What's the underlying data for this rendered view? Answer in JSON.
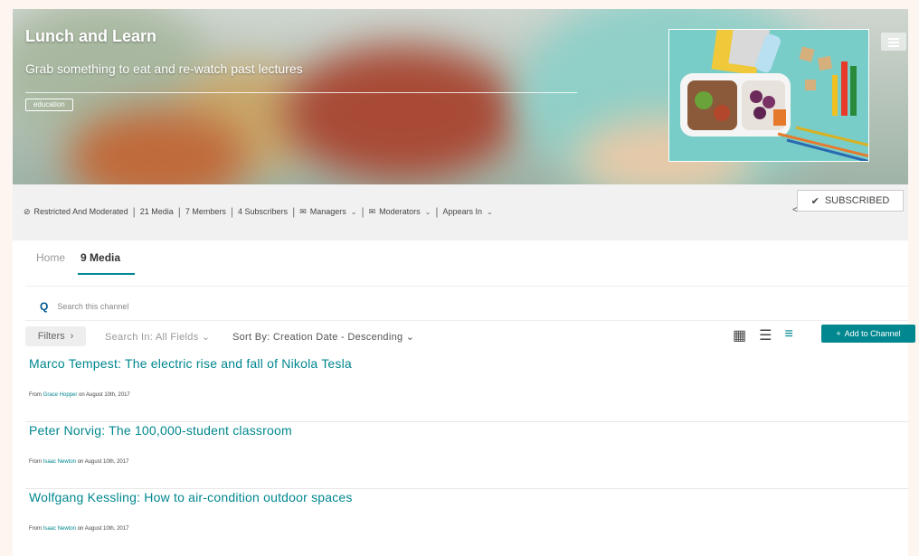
{
  "channel": {
    "title": "Lunch and Learn",
    "description": "Grab something to eat and re-watch past lectures",
    "tag": "education"
  },
  "infobar": {
    "restricted": "Restricted And Moderated",
    "media": "21  Media",
    "members": "7  Members",
    "subscribers": "4  Subscribers",
    "managers": "Managers",
    "moderators": "Moderators",
    "appears_in": "Appears In",
    "subscribed_label": "SUBSCRIBED"
  },
  "tabs": [
    {
      "label": "Home"
    },
    {
      "label": "9 Media"
    }
  ],
  "search": {
    "placeholder": "Search this channel"
  },
  "toolbar": {
    "filters_label": "Filters",
    "search_in": "Search In: All Fields",
    "sort_by": "Sort By: Creation Date - Descending",
    "add_label": "Add to Channel"
  },
  "media": [
    {
      "title": "Marco Tempest: The electric rise and fall of Nikola Tesla",
      "from": "From ",
      "author": "Grace Hopper",
      "date": " on August 10th, 2017"
    },
    {
      "title": "Peter Norvig: The 100,000-student classroom",
      "from": "From ",
      "author": "Isaac Newton",
      "date": " on August 10th, 2017"
    },
    {
      "title": "Wolfgang Kessling: How to air-condition outdoor spaces",
      "from": "From ",
      "author": "Isaac Newton",
      "date": " on August 10th, 2017"
    }
  ],
  "colors": {
    "accent": "#00878f",
    "link": "#00578f"
  }
}
